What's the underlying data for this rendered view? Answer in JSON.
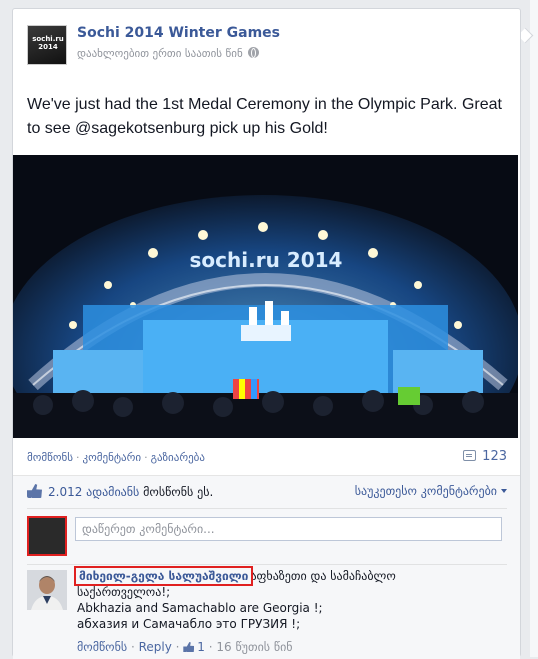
{
  "post": {
    "page_name": "Sochi 2014 Winter Games",
    "timestamp": "დაახლოებით ერთი საათის წინ",
    "logo_text": "sochi.ru 2014",
    "text": "We've just had the 1st Medal Ceremony in the Olympic Park. Great to see @sagekotsenburg pick up his Gold!",
    "photo_sign": "sochi.ru 2014",
    "photo_sign_small": "2014"
  },
  "actions": {
    "like": "მომწონს",
    "comment": "კომენტარი",
    "share": "გაზიარება",
    "comment_count": "123"
  },
  "ufi": {
    "likes_count": "2.012 ადამიანს",
    "likes_rest": "მოსწონს ეს.",
    "sort_label": "საუკეთესო კომენტარები",
    "comment_placeholder": "დაწერეთ კომენტარი..."
  },
  "comment": {
    "author": "მიხეილ-გელა სალუაშვილი",
    "line1": "აფხაზეთი და სამაჩაბლო",
    "line2": "საქართველოა!;",
    "line3": "Abkhazia and Samachablo are Georgia !;",
    "line4": "абхазия и Самачабло это ГРУЗИЯ !;",
    "like_label": "მომწონს",
    "reply_label": "Reply",
    "likes": "1",
    "time": "16 წუთის წინ"
  },
  "colors": {
    "brand_link": "#3b5998",
    "highlight_box": "#e02020"
  }
}
